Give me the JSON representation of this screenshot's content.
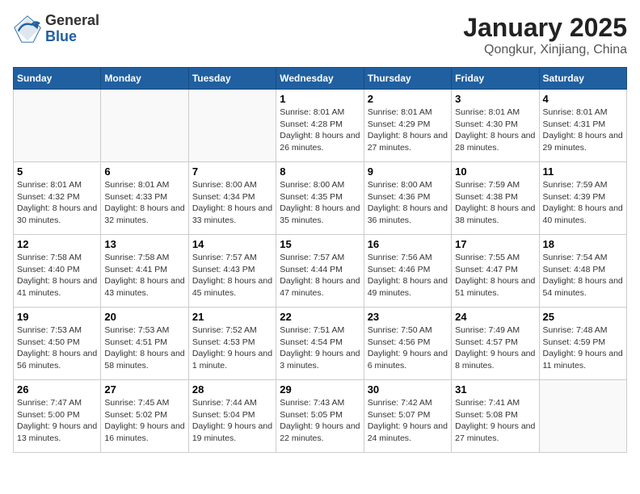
{
  "header": {
    "logo_general": "General",
    "logo_blue": "Blue",
    "title": "January 2025",
    "subtitle": "Qongkur, Xinjiang, China"
  },
  "weekdays": [
    "Sunday",
    "Monday",
    "Tuesday",
    "Wednesday",
    "Thursday",
    "Friday",
    "Saturday"
  ],
  "weeks": [
    [
      {
        "day": "",
        "content": ""
      },
      {
        "day": "",
        "content": ""
      },
      {
        "day": "",
        "content": ""
      },
      {
        "day": "1",
        "content": "Sunrise: 8:01 AM\nSunset: 4:28 PM\nDaylight: 8 hours and 26 minutes."
      },
      {
        "day": "2",
        "content": "Sunrise: 8:01 AM\nSunset: 4:29 PM\nDaylight: 8 hours and 27 minutes."
      },
      {
        "day": "3",
        "content": "Sunrise: 8:01 AM\nSunset: 4:30 PM\nDaylight: 8 hours and 28 minutes."
      },
      {
        "day": "4",
        "content": "Sunrise: 8:01 AM\nSunset: 4:31 PM\nDaylight: 8 hours and 29 minutes."
      }
    ],
    [
      {
        "day": "5",
        "content": "Sunrise: 8:01 AM\nSunset: 4:32 PM\nDaylight: 8 hours and 30 minutes."
      },
      {
        "day": "6",
        "content": "Sunrise: 8:01 AM\nSunset: 4:33 PM\nDaylight: 8 hours and 32 minutes."
      },
      {
        "day": "7",
        "content": "Sunrise: 8:00 AM\nSunset: 4:34 PM\nDaylight: 8 hours and 33 minutes."
      },
      {
        "day": "8",
        "content": "Sunrise: 8:00 AM\nSunset: 4:35 PM\nDaylight: 8 hours and 35 minutes."
      },
      {
        "day": "9",
        "content": "Sunrise: 8:00 AM\nSunset: 4:36 PM\nDaylight: 8 hours and 36 minutes."
      },
      {
        "day": "10",
        "content": "Sunrise: 7:59 AM\nSunset: 4:38 PM\nDaylight: 8 hours and 38 minutes."
      },
      {
        "day": "11",
        "content": "Sunrise: 7:59 AM\nSunset: 4:39 PM\nDaylight: 8 hours and 40 minutes."
      }
    ],
    [
      {
        "day": "12",
        "content": "Sunrise: 7:58 AM\nSunset: 4:40 PM\nDaylight: 8 hours and 41 minutes."
      },
      {
        "day": "13",
        "content": "Sunrise: 7:58 AM\nSunset: 4:41 PM\nDaylight: 8 hours and 43 minutes."
      },
      {
        "day": "14",
        "content": "Sunrise: 7:57 AM\nSunset: 4:43 PM\nDaylight: 8 hours and 45 minutes."
      },
      {
        "day": "15",
        "content": "Sunrise: 7:57 AM\nSunset: 4:44 PM\nDaylight: 8 hours and 47 minutes."
      },
      {
        "day": "16",
        "content": "Sunrise: 7:56 AM\nSunset: 4:46 PM\nDaylight: 8 hours and 49 minutes."
      },
      {
        "day": "17",
        "content": "Sunrise: 7:55 AM\nSunset: 4:47 PM\nDaylight: 8 hours and 51 minutes."
      },
      {
        "day": "18",
        "content": "Sunrise: 7:54 AM\nSunset: 4:48 PM\nDaylight: 8 hours and 54 minutes."
      }
    ],
    [
      {
        "day": "19",
        "content": "Sunrise: 7:53 AM\nSunset: 4:50 PM\nDaylight: 8 hours and 56 minutes."
      },
      {
        "day": "20",
        "content": "Sunrise: 7:53 AM\nSunset: 4:51 PM\nDaylight: 8 hours and 58 minutes."
      },
      {
        "day": "21",
        "content": "Sunrise: 7:52 AM\nSunset: 4:53 PM\nDaylight: 9 hours and 1 minute."
      },
      {
        "day": "22",
        "content": "Sunrise: 7:51 AM\nSunset: 4:54 PM\nDaylight: 9 hours and 3 minutes."
      },
      {
        "day": "23",
        "content": "Sunrise: 7:50 AM\nSunset: 4:56 PM\nDaylight: 9 hours and 6 minutes."
      },
      {
        "day": "24",
        "content": "Sunrise: 7:49 AM\nSunset: 4:57 PM\nDaylight: 9 hours and 8 minutes."
      },
      {
        "day": "25",
        "content": "Sunrise: 7:48 AM\nSunset: 4:59 PM\nDaylight: 9 hours and 11 minutes."
      }
    ],
    [
      {
        "day": "26",
        "content": "Sunrise: 7:47 AM\nSunset: 5:00 PM\nDaylight: 9 hours and 13 minutes."
      },
      {
        "day": "27",
        "content": "Sunrise: 7:45 AM\nSunset: 5:02 PM\nDaylight: 9 hours and 16 minutes."
      },
      {
        "day": "28",
        "content": "Sunrise: 7:44 AM\nSunset: 5:04 PM\nDaylight: 9 hours and 19 minutes."
      },
      {
        "day": "29",
        "content": "Sunrise: 7:43 AM\nSunset: 5:05 PM\nDaylight: 9 hours and 22 minutes."
      },
      {
        "day": "30",
        "content": "Sunrise: 7:42 AM\nSunset: 5:07 PM\nDaylight: 9 hours and 24 minutes."
      },
      {
        "day": "31",
        "content": "Sunrise: 7:41 AM\nSunset: 5:08 PM\nDaylight: 9 hours and 27 minutes."
      },
      {
        "day": "",
        "content": ""
      }
    ]
  ]
}
